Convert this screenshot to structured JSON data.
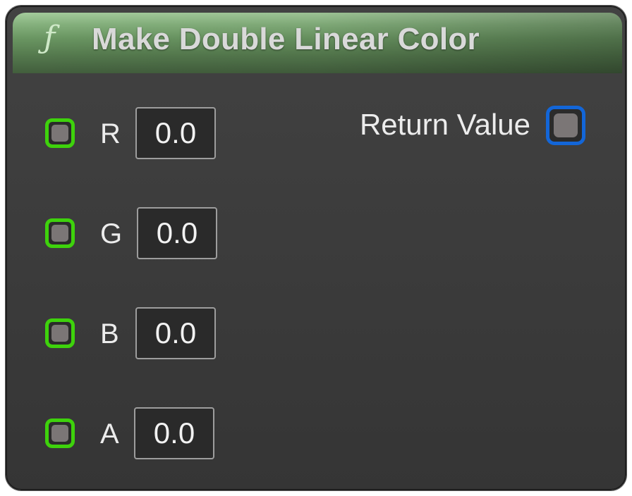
{
  "node": {
    "icon": "function-icon",
    "icon_glyph": "ƒ",
    "title": "Make Double Linear Color",
    "header_color": "#6a9662",
    "inputs": [
      {
        "label": "R",
        "value": "0.0",
        "pin_color": "#3ed20c"
      },
      {
        "label": "G",
        "value": "0.0",
        "pin_color": "#3ed20c"
      },
      {
        "label": "B",
        "value": "0.0",
        "pin_color": "#3ed20c"
      },
      {
        "label": "A",
        "value": "0.0",
        "pin_color": "#3ed20c"
      }
    ],
    "output": {
      "label": "Return Value",
      "pin_color": "#1366d8"
    }
  }
}
